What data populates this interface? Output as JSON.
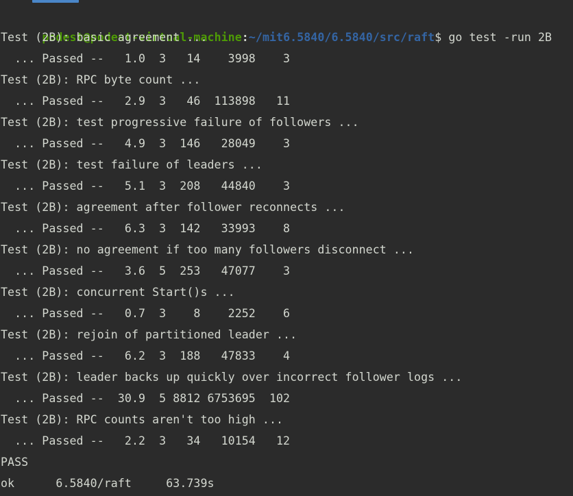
{
  "window": {
    "background_color": "#2b2b2b",
    "foreground_color": "#d3d7cf",
    "tab_indicator_color": "#4a86c8"
  },
  "prompt": {
    "user_host": "podest@podest-virtual-machine",
    "separator": ":",
    "path": "~/mit6.5840/6.5840/src/raft",
    "symbol": "$",
    "command": " go test -run 2B",
    "user_color": "#4e9a06",
    "path_color": "#3465a4"
  },
  "tests": [
    {
      "header": "Test (2B): basic agreement ...",
      "result": "  ... Passed --   1.0  3   14    3998    3"
    },
    {
      "header": "Test (2B): RPC byte count ...",
      "result": "  ... Passed --   2.9  3   46  113898   11"
    },
    {
      "header": "Test (2B): test progressive failure of followers ...",
      "result": "  ... Passed --   4.9  3  146   28049    3"
    },
    {
      "header": "Test (2B): test failure of leaders ...",
      "result": "  ... Passed --   5.1  3  208   44840    3"
    },
    {
      "header": "Test (2B): agreement after follower reconnects ...",
      "result": "  ... Passed --   6.3  3  142   33993    8"
    },
    {
      "header": "Test (2B): no agreement if too many followers disconnect ...",
      "result": "  ... Passed --   3.6  5  253   47077    3"
    },
    {
      "header": "Test (2B): concurrent Start()s ...",
      "result": "  ... Passed --   0.7  3    8    2252    6"
    },
    {
      "header": "Test (2B): rejoin of partitioned leader ...",
      "result": "  ... Passed --   6.2  3  188   47833    4"
    },
    {
      "header": "Test (2B): leader backs up quickly over incorrect follower logs ...",
      "result": "  ... Passed --  30.9  5 8812 6753695  102"
    },
    {
      "header": "Test (2B): RPC counts aren't too high ...",
      "result": "  ... Passed --   2.2  3   34   10154   12"
    }
  ],
  "summary": {
    "pass_line": "PASS",
    "ok_line": "ok  \t6.5840/raft\t63.739s"
  }
}
